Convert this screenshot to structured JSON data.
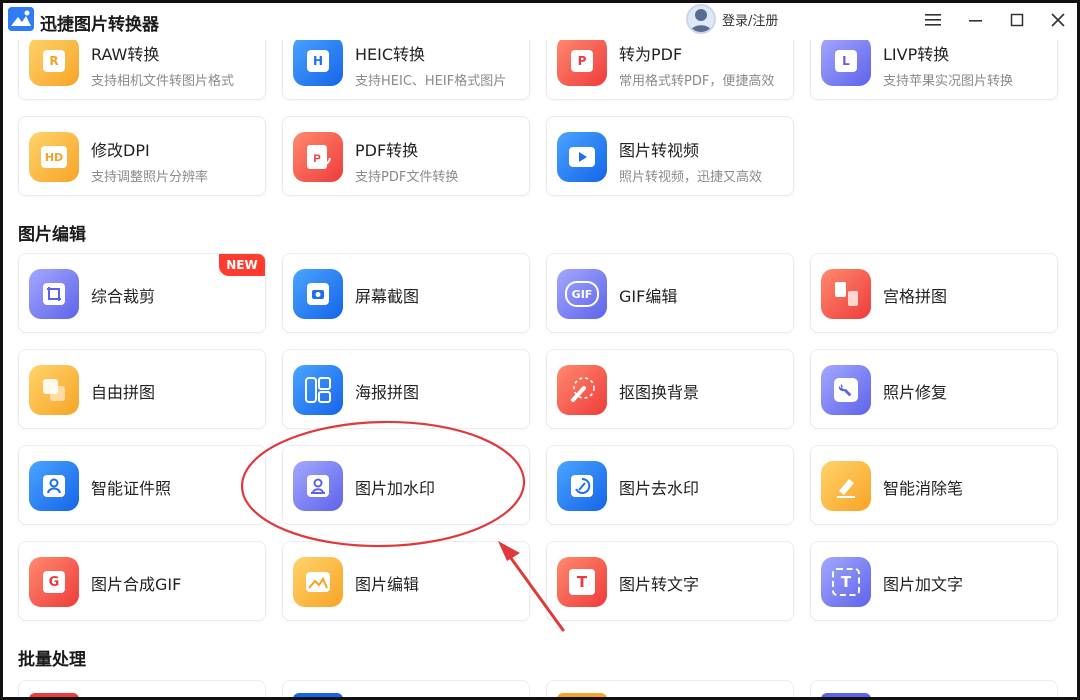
{
  "app": {
    "title": "迅捷图片转换器",
    "login_label": "登录/注册"
  },
  "colors": {
    "accent_blue": "#2f7cf6",
    "annotation_red": "#e0393b",
    "new_badge": "#ff3b30"
  },
  "convert_row1": [
    {
      "label": "RAW转换",
      "desc": "支持相机文件转图片格式",
      "icon": "raw-icon",
      "glyph": "R"
    },
    {
      "label": "HEIC转换",
      "desc": "支持HEIC、HEIF格式图片",
      "icon": "heic-icon",
      "glyph": "H"
    },
    {
      "label": "转为PDF",
      "desc": "常用格式转PDF，便捷高效",
      "icon": "pdf-icon",
      "glyph": "P"
    },
    {
      "label": "LIVP转换",
      "desc": "支持苹果实况图片转换",
      "icon": "livp-icon",
      "glyph": "L"
    }
  ],
  "convert_row2": [
    {
      "label": "修改DPI",
      "desc": "支持调整照片分辨率",
      "icon": "dpi-icon",
      "glyph": "HD"
    },
    {
      "label": "PDF转换",
      "desc": "支持PDF文件转换",
      "icon": "pdf-convert-icon",
      "glyph": "P"
    },
    {
      "label": "图片转视频",
      "desc": "照片转视频，迅捷又高效",
      "icon": "video-icon",
      "glyph": "▶"
    }
  ],
  "edit_section": {
    "title": "图片编辑",
    "new_badge": "NEW",
    "rows": [
      [
        {
          "label": "综合裁剪",
          "icon": "crop-icon"
        },
        {
          "label": "屏幕截图",
          "icon": "screenshot-icon"
        },
        {
          "label": "GIF编辑",
          "icon": "gif-icon",
          "glyph": "GIF"
        },
        {
          "label": "宫格拼图",
          "icon": "grid-collage-icon"
        }
      ],
      [
        {
          "label": "自由拼图",
          "icon": "free-collage-icon"
        },
        {
          "label": "海报拼图",
          "icon": "poster-collage-icon"
        },
        {
          "label": "抠图换背景",
          "icon": "cutout-icon"
        },
        {
          "label": "照片修复",
          "icon": "repair-icon"
        }
      ],
      [
        {
          "label": "智能证件照",
          "icon": "id-photo-icon"
        },
        {
          "label": "图片加水印",
          "icon": "add-watermark-icon"
        },
        {
          "label": "图片去水印",
          "icon": "remove-watermark-icon"
        },
        {
          "label": "智能消除笔",
          "icon": "eraser-icon"
        }
      ],
      [
        {
          "label": "图片合成GIF",
          "icon": "make-gif-icon",
          "glyph": "G"
        },
        {
          "label": "图片编辑",
          "icon": "image-edit-icon"
        },
        {
          "label": "图片转文字",
          "icon": "ocr-icon",
          "glyph": "T"
        },
        {
          "label": "图片加文字",
          "icon": "add-text-icon",
          "glyph": "T"
        }
      ]
    ]
  },
  "batch_section": {
    "title": "批量处理"
  }
}
